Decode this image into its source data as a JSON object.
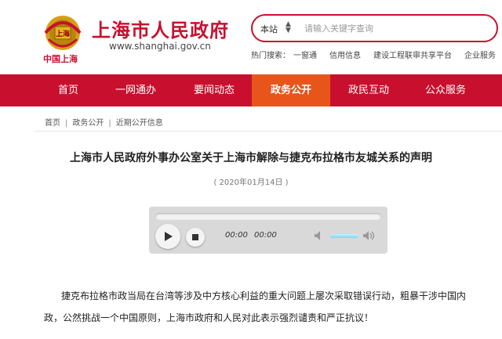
{
  "header": {
    "emblem_caption": "中国上海",
    "site_title": "上海市人民政府",
    "site_url": "www.shanghai.gov.cn",
    "emblem_text": "上海"
  },
  "search": {
    "scope": "本站",
    "placeholder": "请输入关键字查询"
  },
  "hot_search": {
    "label": "热门搜索：",
    "items": [
      "一窗通",
      "信用信息",
      "建设工程联审共享平台",
      "企业服务"
    ]
  },
  "nav": {
    "items": [
      "首页",
      "一网通办",
      "要闻动态",
      "政务公开",
      "政民互动",
      "公众服务"
    ],
    "active_index": 3
  },
  "breadcrumb": {
    "items": [
      "首页",
      "政务公开",
      "近期公开信息"
    ],
    "separator": "|"
  },
  "article": {
    "title": "上海市人民政府外事办公室关于上海市解除与捷克布拉格市友城关系的声明",
    "date": "( 2020年01月14日 )",
    "paragraph_line1": "捷克布拉格市政当局在台湾等涉及中方核心利益的重大问题上屡次采取错误行动，粗暴干涉中国内",
    "paragraph_line2": "政，公然挑战一个中国原则，上海市政府和人民对此表示强烈谴责和严正抗议！"
  },
  "player": {
    "current_time": "00:00",
    "duration": "00:00",
    "progress": 0,
    "volume": 0.9
  },
  "colors": {
    "brand_red": "#c8102e",
    "active_orange": "#e8551a"
  }
}
